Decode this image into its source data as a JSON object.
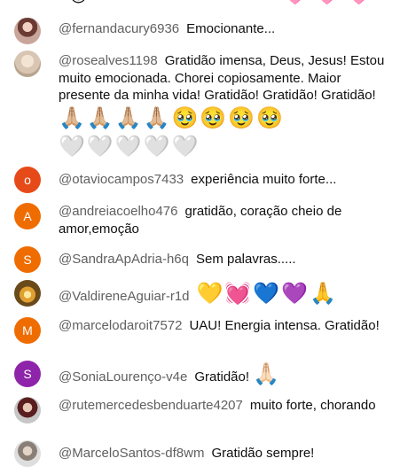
{
  "chat": {
    "top_partial_emojis": [
      "😊",
      "🩷",
      "🩷",
      "🩷"
    ],
    "messages": [
      {
        "avatar": {
          "type": "photo",
          "style": "photo-a"
        },
        "author": "@fernandacury6936",
        "text": "Emocionante..."
      },
      {
        "avatar": {
          "type": "photo",
          "style": "photo-b"
        },
        "author": "@rosealves1198",
        "text": "Gratidão imensa, Deus, Jesus! Estou muito emocionada. Chorei copiosamente. Maior presente da minha vida! Gratidão! Gratidão! Gratidão!",
        "emojis": "🙏🏼🙏🏼🙏🏼🙏🏼🥹🥹🥹🥹",
        "emojis2": "🤍🤍🤍🤍🤍"
      },
      {
        "avatar": {
          "type": "letter",
          "letter": "o",
          "color": "#e64a19"
        },
        "author": "@otaviocampos7433",
        "text": "experiência muito forte..."
      },
      {
        "avatar": {
          "type": "letter",
          "letter": "A",
          "color": "#ef6c00"
        },
        "author": "@andreiacoelho476",
        "text": "gratidão, coração cheio de amor,emoção"
      },
      {
        "avatar": {
          "type": "letter",
          "letter": "S",
          "color": "#ef6c00"
        },
        "author": "@SandraApAdria-h6q",
        "text": "Sem palavras....."
      },
      {
        "avatar": {
          "type": "photo",
          "style": "photo-c"
        },
        "author": "@ValdireneAguiar-r1d",
        "text": "",
        "emojis": "💛💓💙💜🙏"
      },
      {
        "avatar": {
          "type": "letter",
          "letter": "M",
          "color": "#ef6c00"
        },
        "author": "@marcelodaroit7572",
        "text": "UAU! Energia intensa. Gratidão!"
      },
      {
        "avatar": {
          "type": "letter",
          "letter": "S",
          "color": "#8e24aa"
        },
        "author": "@SoniaLourenço-v4e",
        "text": "Gratidão!",
        "emojis": "🙏🏻"
      },
      {
        "avatar": {
          "type": "photo",
          "style": "photo-d"
        },
        "author": "@rutemercedesbenduarte4207",
        "text": "muito forte, chorando"
      },
      {
        "avatar": {
          "type": "photo",
          "style": "photo-e"
        },
        "author": "@MarceloSantos-df8wm",
        "text": "Gratidão sempre!"
      }
    ]
  }
}
